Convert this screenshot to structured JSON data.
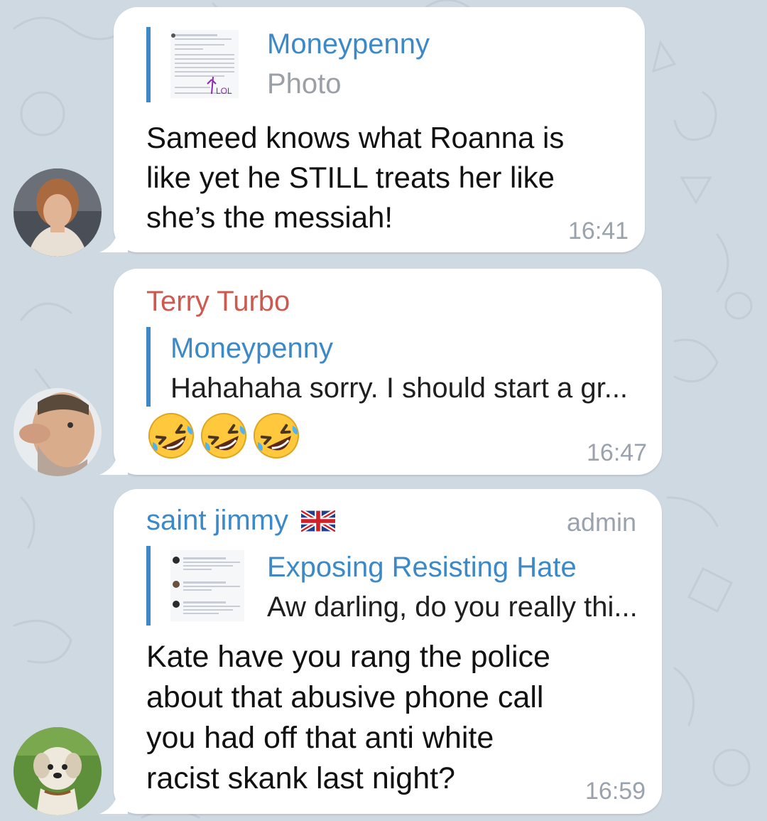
{
  "messages": [
    {
      "reply": {
        "name": "Moneypenny",
        "text": "Photo",
        "thumb_annotation": "LOL"
      },
      "text_lines": [
        "Sameed knows what Roanna is",
        "like yet he STILL treats her like",
        "she’s the messiah!"
      ],
      "time": "16:41"
    },
    {
      "sender": "Terry Turbo",
      "reply": {
        "name": "Moneypenny",
        "text": "Hahahaha sorry. I should start a gr..."
      },
      "emoji_icon": "rolling-on-floor-laughing",
      "emoji_count": 3,
      "time": "16:47"
    },
    {
      "sender": "saint jimmy",
      "sender_flag_icon": "uk-flag",
      "badge": "admin",
      "reply": {
        "name": "Exposing Resisting Hate",
        "text": "Aw darling, do you really thi..."
      },
      "text_lines": [
        "Kate have you rang the police",
        "about that abusive phone call",
        "you had off that anti white",
        "racist skank last night?"
      ],
      "time": "16:59"
    }
  ],
  "colors": {
    "background": "#cfd9e2",
    "bubble": "#ffffff",
    "link_blue": "#3d89c7",
    "sender_red": "#cc5a4f",
    "muted": "#9aa3ad"
  }
}
